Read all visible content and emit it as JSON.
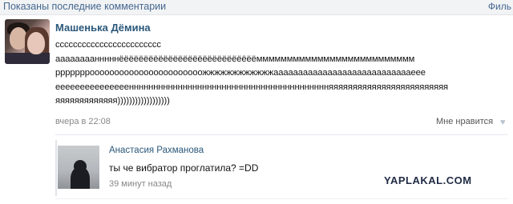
{
  "header": {
    "title": "Показаны последние комментарии",
    "filter_label": "Филь"
  },
  "comment": {
    "author": "Машенька Дёмина",
    "lines": [
      "сссссссссссссссссссссссс",
      "аааааааанннннёёёёёёёёёёёёёёёёёёёёёёёёёёёёмммммммммммммммммммммммммм",
      "рррррррооооооооооооооооооооооожжжжжжжжжжжжааааааааааааааааааааааааааааеее",
      "еееееееееееееееннннннннннннннннннннннннннннннннннннннннняяяяяяяяяяяяяяяяяяяяяяяяя",
      "яяяяяяяяяяяяя))))))))))))))))))"
    ],
    "time": "вчера в 22:08",
    "like_label": "Мне нравится",
    "like_icon": "heart-icon"
  },
  "reply": {
    "author": "Анастасия Рахманова",
    "text": "ты че вибратор проглатила? =DD",
    "time": "39 минут назад"
  },
  "watermark": "YAPLAKAL.COM",
  "colors": {
    "link": "#2b587a",
    "header_bg": "#f2f3f5",
    "muted": "#888888"
  }
}
